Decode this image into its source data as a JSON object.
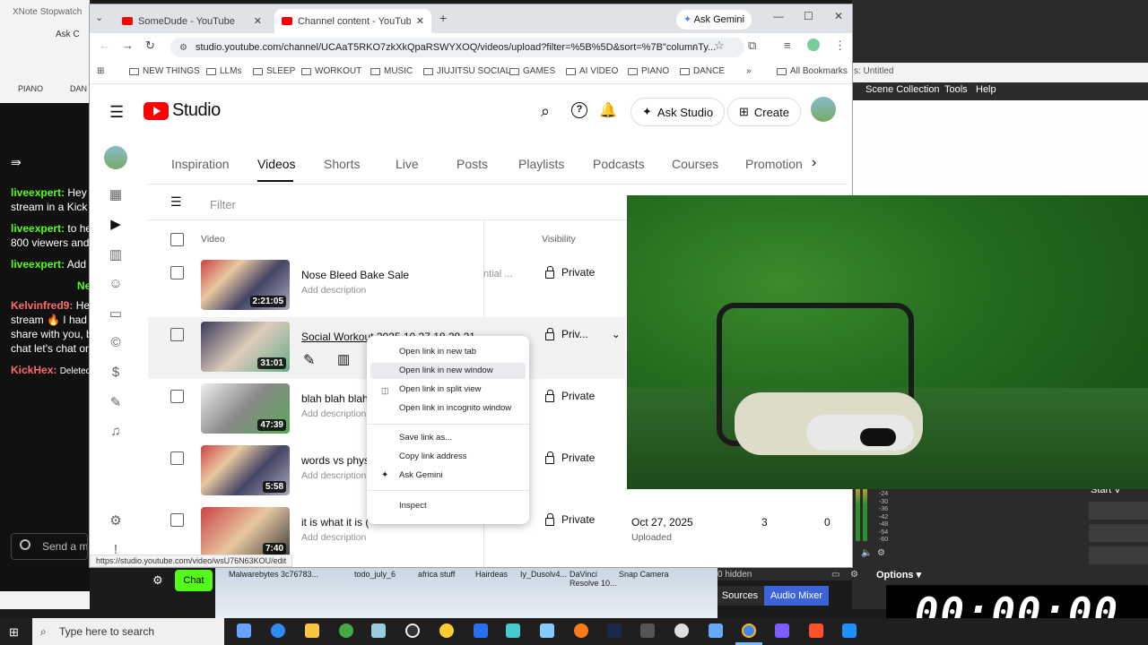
{
  "desktop": {
    "left_window_title": "XNote Stopwatch",
    "left_window_tab": "Ask C",
    "left_bookmarks": [
      "PIANO",
      "DAN"
    ],
    "chat": {
      "lines": [
        {
          "user": "liveexpert:",
          "text": "Hey h"
        },
        {
          "text": "stream in a Kick c"
        },
        {
          "user": "liveexpert:",
          "text": "to hel"
        },
        {
          "text": "800 viewers and"
        },
        {
          "user": "liveexpert:",
          "text": "Add n"
        },
        {
          "user": "Kelvinfred9:",
          "text": "Hey"
        },
        {
          "text": "stream 🔥 I had s"
        },
        {
          "text": "share with you, b"
        },
        {
          "text": "chat let's chat on"
        },
        {
          "user": "KickHex:",
          "text": "Deleted"
        }
      ],
      "ne_label": "Ne",
      "send_placeholder": "Send a me",
      "chat_button": "Chat"
    },
    "obs": {
      "title_snippet": "s: Untitled",
      "menu": [
        "Scene Collection",
        "Tools",
        "Help"
      ],
      "options_label": "Options",
      "sources_tab": "Sources",
      "audio_mixer_tab": "Audio Mixer",
      "hidden_label": "0 hidden",
      "start_label": "Start V",
      "meter_labels": [
        "-24",
        "-30",
        "-36",
        "-42",
        "-48",
        "-54",
        "-60"
      ]
    },
    "timer": "00:00:00",
    "desktop_icons": [
      "Malwarebytes 3c76783...",
      "todo_july_6",
      "africa stuff",
      "Hairdeas",
      "Iy_Dusolv4...",
      "DaVinci Resolve 10...",
      "Snap Camera"
    ],
    "taskbar": {
      "search_placeholder": "Type here to search"
    }
  },
  "browser": {
    "tabs": [
      {
        "label": "SomeDude - YouTube"
      },
      {
        "label": "Channel content - YouTube Stu"
      }
    ],
    "ask_gemini": "Ask Gemini",
    "url": "studio.youtube.com/channel/UCAaT5RKO7zkXkQpaRSWYXOQ/videos/upload?filter=%5B%5D&sort=%7B\"columnTy...",
    "bookmarks": [
      "NEW THINGS",
      "LLMs",
      "SLEEP",
      "WORKOUT",
      "MUSIC",
      "JIUJITSU SOCIAL",
      "GAMES",
      "AI VIDEO",
      "PIANO",
      "DANCE"
    ],
    "all_bookmarks": "All Bookmarks",
    "status_url": "https://studio.youtube.com/video/wsU76N63KOU/edit"
  },
  "studio": {
    "logo": "Studio",
    "ask_studio": "Ask Studio",
    "create": "Create",
    "tabs": [
      "Inspiration",
      "Videos",
      "Shorts",
      "Live",
      "Posts",
      "Playlists",
      "Podcasts",
      "Courses",
      "Promotion"
    ],
    "active_tab": "Videos",
    "filter_placeholder": "Filter",
    "col_video": "Video",
    "col_visibility": "Visibility",
    "rows": [
      {
        "title": "Nose Bleed Bake Sale",
        "desc": "Add description",
        "duration": "2:21:05",
        "visibility": "Private",
        "extra": "ntial ..."
      },
      {
        "title": "Social Workout 2025 10 27 18 28 21",
        "desc": "",
        "duration": "31:01",
        "visibility": "Priv..."
      },
      {
        "title": "blah blah blah",
        "desc": "Add description",
        "duration": "47:39",
        "visibility": "Private"
      },
      {
        "title": "words vs phys",
        "desc": "Add description",
        "duration": "5:58",
        "visibility": "Private"
      },
      {
        "title": "it is what it is (",
        "desc": "Add description",
        "duration": "7:40",
        "visibility": "Private",
        "date": "Oct 27, 2025",
        "status": "Uploaded",
        "views": "3",
        "comments": "0"
      }
    ]
  },
  "context_menu": {
    "items": [
      "Open link in new tab",
      "Open link in new window",
      "Open link in split view",
      "Open link in incognito window",
      "Save link as...",
      "Copy link address",
      "Ask Gemini",
      "Inspect"
    ]
  },
  "colors": {
    "youtube_red": "#ff0000",
    "chat_green": "#53fc18",
    "obs_blue": "#3c64d8"
  }
}
